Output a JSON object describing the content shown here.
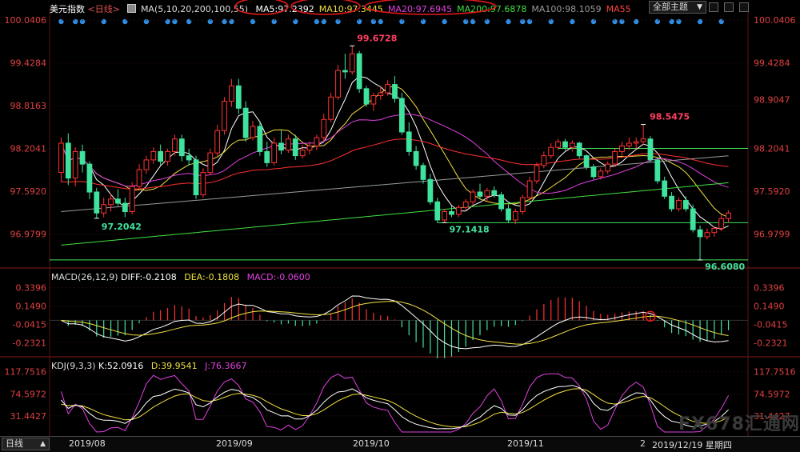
{
  "header": {
    "symbol": "美元指数",
    "period_link": "<日线>",
    "ma_title": "MA(5,10,20,200,100,55)",
    "ma_items": [
      {
        "text": "MA5:97.2392",
        "color": "#ffffff"
      },
      {
        "text": "MA10:97.3445",
        "color": "#f0e040"
      },
      {
        "text": "MA20:97.6945",
        "color": "#e040e0"
      },
      {
        "text": "MA200:97.6878",
        "color": "#40e040"
      },
      {
        "text": "MA100:98.1059",
        "color": "#999999"
      },
      {
        "text": "MA55",
        "color": "#ff4040"
      }
    ],
    "theme_select": "全部主题",
    "theme_arrow": "▼"
  },
  "macd_header": {
    "title": "MACD(26,12,9)",
    "diff": "DIFF:-0.2108",
    "dea": "DEA:-0.1808",
    "macd": "MACD:-0.0600"
  },
  "kdj_header": {
    "title": "KDJ(9,3,3)",
    "k": "K:52.0916",
    "d": "D:39.9541",
    "j": "J:76.3667"
  },
  "bottom_bar": {
    "period_button": "日线",
    "period_arrow": "▲",
    "dates": [
      "2019/08",
      "2019/09",
      "2019/10",
      "2019/11",
      "2019/12/19 星期四"
    ],
    "small_label": "2"
  },
  "watermark": "FX678汇通网",
  "colors": {
    "up": "#ff3232",
    "down": "#3fe39e",
    "ma5": "#ffffff",
    "ma10": "#f0e040",
    "ma20": "#e040e0",
    "ma55": "#ff3030",
    "ma100": "#999999",
    "ma200": "#40e040",
    "axis_text": "#e04040",
    "dots": "#2f8de4"
  },
  "chart_data": [
    {
      "type": "candlestick",
      "title": "美元指数",
      "y_ticks": [
        "100.0406",
        "99.4284",
        "98.8163",
        "98.2041",
        "97.5920",
        "96.9799"
      ],
      "right_ticks": [
        "100.0406",
        "99.4284",
        "98.9047",
        "98.2041",
        "97.5920",
        "96.9799"
      ],
      "ylim": [
        96.55,
        100.1
      ],
      "annotations": [
        {
          "text": "99.6728",
          "value": 99.6728
        },
        {
          "text": "98.5475",
          "value": 98.5475
        },
        {
          "text": "97.2042",
          "value": 97.2042
        },
        {
          "text": "97.1418",
          "value": 97.1418
        },
        {
          "text": "96.6080",
          "value": 96.608
        }
      ],
      "ohlc": [
        [
          97.86,
          98.36,
          97.72,
          98.28
        ],
        [
          98.28,
          98.42,
          97.68,
          97.78
        ],
        [
          97.78,
          98.22,
          97.66,
          98.16
        ],
        [
          98.16,
          98.26,
          97.86,
          97.98
        ],
        [
          97.98,
          98.02,
          97.48,
          97.58
        ],
        [
          97.58,
          97.64,
          97.2042,
          97.28
        ],
        [
          97.28,
          97.5,
          97.22,
          97.4
        ],
        [
          97.4,
          97.56,
          97.3,
          97.48
        ],
        [
          97.48,
          97.62,
          97.38,
          97.42
        ],
        [
          97.42,
          97.5,
          97.22,
          97.3
        ],
        [
          97.3,
          97.72,
          97.26,
          97.66
        ],
        [
          97.66,
          97.98,
          97.6,
          97.9
        ],
        [
          97.9,
          98.1,
          97.84,
          98.04
        ],
        [
          98.04,
          98.22,
          97.98,
          98.16
        ],
        [
          98.16,
          98.26,
          97.96,
          98.02
        ],
        [
          98.02,
          98.2,
          97.96,
          98.16
        ],
        [
          98.16,
          98.4,
          98.1,
          98.34
        ],
        [
          98.34,
          98.4,
          98.02,
          98.1
        ],
        [
          98.1,
          98.2,
          97.96,
          98.04
        ],
        [
          98.04,
          98.1,
          97.48,
          97.54
        ],
        [
          97.54,
          97.92,
          97.5,
          97.86
        ],
        [
          97.86,
          98.2,
          97.82,
          98.14
        ],
        [
          98.14,
          98.54,
          98.1,
          98.46
        ],
        [
          98.46,
          98.94,
          98.4,
          98.88
        ],
        [
          98.88,
          99.2,
          98.8,
          99.1
        ],
        [
          99.1,
          99.2,
          98.7,
          98.78
        ],
        [
          98.78,
          98.88,
          98.3,
          98.36
        ],
        [
          98.36,
          98.6,
          98.32,
          98.52
        ],
        [
          98.52,
          98.6,
          98.1,
          98.16
        ],
        [
          98.16,
          98.3,
          97.94,
          98.0
        ],
        [
          98.0,
          98.36,
          97.96,
          98.28
        ],
        [
          98.28,
          98.46,
          98.12,
          98.18
        ],
        [
          98.18,
          98.4,
          98.14,
          98.34
        ],
        [
          98.34,
          98.4,
          98.04,
          98.1
        ],
        [
          98.1,
          98.26,
          98.06,
          98.18
        ],
        [
          98.18,
          98.3,
          98.12,
          98.24
        ],
        [
          98.24,
          98.4,
          98.18,
          98.36
        ],
        [
          98.36,
          98.7,
          98.3,
          98.62
        ],
        [
          98.62,
          99.0,
          98.58,
          98.94
        ],
        [
          98.94,
          99.4,
          98.9,
          99.32
        ],
        [
          99.32,
          99.56,
          99.2,
          99.3
        ],
        [
          99.3,
          99.6728,
          99.26,
          99.56
        ],
        [
          99.56,
          99.6,
          99.0,
          99.06
        ],
        [
          99.06,
          99.1,
          98.8,
          98.84
        ],
        [
          98.84,
          99.0,
          98.74,
          98.96
        ],
        [
          98.96,
          99.1,
          98.9,
          99.0
        ],
        [
          99.0,
          99.18,
          98.96,
          99.12
        ],
        [
          99.12,
          99.24,
          98.86,
          98.92
        ],
        [
          98.92,
          99.0,
          98.4,
          98.44
        ],
        [
          98.44,
          98.58,
          98.1,
          98.16
        ],
        [
          98.16,
          98.24,
          97.9,
          97.96
        ],
        [
          97.96,
          98.0,
          97.7,
          97.76
        ],
        [
          97.76,
          97.84,
          97.4,
          97.44
        ],
        [
          97.44,
          97.5,
          97.14,
          97.18
        ],
        [
          97.18,
          97.34,
          97.1418,
          97.3
        ],
        [
          97.3,
          97.38,
          97.22,
          97.26
        ],
        [
          97.26,
          97.4,
          97.22,
          97.36
        ],
        [
          97.36,
          97.48,
          97.32,
          97.44
        ],
        [
          97.44,
          97.62,
          97.4,
          97.58
        ],
        [
          97.58,
          97.7,
          97.48,
          97.52
        ],
        [
          97.52,
          97.64,
          97.44,
          97.6
        ],
        [
          97.6,
          97.66,
          97.5,
          97.54
        ],
        [
          97.54,
          97.58,
          97.3,
          97.34
        ],
        [
          97.34,
          97.4,
          97.14,
          97.18
        ],
        [
          97.18,
          97.34,
          97.12,
          97.3
        ],
        [
          97.3,
          97.54,
          97.26,
          97.5
        ],
        [
          97.5,
          97.8,
          97.46,
          97.74
        ],
        [
          97.74,
          98.0,
          97.7,
          97.96
        ],
        [
          97.96,
          98.16,
          97.92,
          98.1
        ],
        [
          98.1,
          98.28,
          98.06,
          98.22
        ],
        [
          98.22,
          98.34,
          98.18,
          98.3
        ],
        [
          98.3,
          98.34,
          98.18,
          98.22
        ],
        [
          98.22,
          98.32,
          98.16,
          98.28
        ],
        [
          98.28,
          98.3,
          98.06,
          98.1
        ],
        [
          98.1,
          98.12,
          97.9,
          97.94
        ],
        [
          97.94,
          97.98,
          97.76,
          97.8
        ],
        [
          97.8,
          97.92,
          97.76,
          97.88
        ],
        [
          97.88,
          98.02,
          97.84,
          97.98
        ],
        [
          97.98,
          98.2,
          97.94,
          98.16
        ],
        [
          98.16,
          98.3,
          98.1,
          98.24
        ],
        [
          98.24,
          98.36,
          98.18,
          98.28
        ],
        [
          98.28,
          98.36,
          98.2,
          98.3
        ],
        [
          98.3,
          98.5475,
          98.26,
          98.34
        ],
        [
          98.34,
          98.38,
          98.0,
          98.04
        ],
        [
          98.04,
          98.08,
          97.7,
          97.74
        ],
        [
          97.74,
          97.8,
          97.48,
          97.52
        ],
        [
          97.52,
          97.58,
          97.3,
          97.34
        ],
        [
          97.34,
          97.5,
          97.3,
          97.46
        ],
        [
          97.46,
          97.52,
          97.3,
          97.34
        ],
        [
          97.34,
          97.4,
          97.0,
          97.04
        ],
        [
          97.04,
          97.1,
          96.608,
          96.94
        ],
        [
          96.94,
          97.06,
          96.9,
          97.0
        ],
        [
          97.0,
          97.08,
          96.94,
          97.06
        ],
        [
          97.06,
          97.26,
          97.02,
          97.2
        ],
        [
          97.2,
          97.32,
          97.14,
          97.28
        ]
      ],
      "support_levels": [
        97.6878,
        97.1418,
        96.608
      ],
      "ma_lines": [
        {
          "name": "MA5"
        },
        {
          "name": "MA10"
        },
        {
          "name": "MA20"
        },
        {
          "name": "MA55"
        },
        {
          "name": "MA100"
        },
        {
          "name": "MA200"
        }
      ]
    },
    {
      "type": "macd",
      "y_ticks": [
        "0.3396",
        "0.1490",
        "-0.0415",
        "-0.2321"
      ],
      "ylim": [
        -0.33,
        0.42
      ],
      "values": {
        "diff": -0.2108,
        "dea": -0.1808,
        "macd": -0.06
      }
    },
    {
      "type": "kdj",
      "y_ticks": [
        "117.7516",
        "74.5972",
        "31.4427"
      ],
      "ylim": [
        0,
        125
      ],
      "values": {
        "k": 52.0916,
        "d": 39.9541,
        "j": 76.3667
      }
    }
  ]
}
